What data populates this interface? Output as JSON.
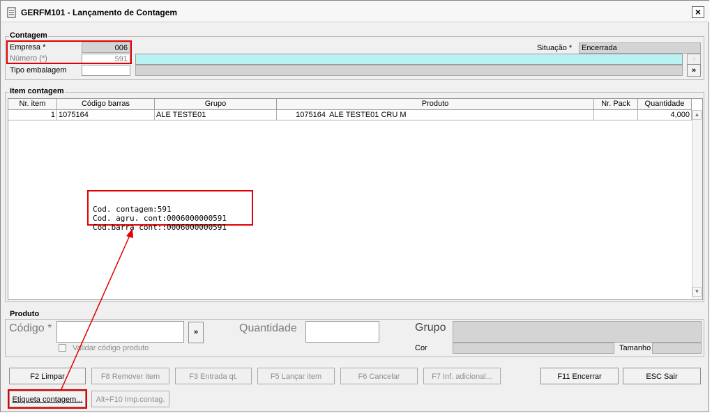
{
  "window": {
    "title": "GERFM101 - Lançamento de Contagem",
    "close_icon": "close-icon"
  },
  "contagem": {
    "legend": "Contagem",
    "empresa_label": "Empresa *",
    "empresa_value": "006",
    "numero_label": "Número (*)",
    "numero_value": "591",
    "tipo_label": "Tipo embalagem",
    "tipo_value": "",
    "situacao_label": "Situação *",
    "situacao_value": "Encerrada",
    "more_label": "»"
  },
  "item_contagem": {
    "legend": "Item contagem",
    "columns": [
      "Nr. item",
      "Código barras",
      "Grupo",
      "Produto",
      "Nr. Pack",
      "Quantidade"
    ],
    "rows": [
      {
        "nr_item": "1",
        "codigo_barras": "1075164",
        "grupo": "ALE TESTE01",
        "produto_code": "1075164",
        "produto_name": "ALE TESTE01 CRU M",
        "nr_pack": "",
        "quantidade": "4,000"
      }
    ]
  },
  "tooltip": {
    "line1": "Cod. contagem:591",
    "line2": "Cod. agru. cont:0006000000591",
    "line3": "Cod.barra cont::0006000000591"
  },
  "produto": {
    "legend": "Produto",
    "codigo_label": "Código *",
    "more_label": "»",
    "quantidade_label": "Quantidade",
    "grupo_label": "Grupo",
    "validar_label": "Validar código produto",
    "cor_label": "Cor",
    "tamanho_label": "Tamanho"
  },
  "buttons": {
    "f2": "F2 Limpar",
    "f8": "F8 Remover item",
    "f3": "F3 Entrada qt.",
    "f5": "F5 Lançar item",
    "f6": "F6 Cancelar",
    "f7": "F7 Inf. adicional...",
    "f11": "F11 Encerrar",
    "esc": "ESC Sair",
    "etiqueta": "Etiqueta contagem...",
    "altf10": "Alt+F10 Imp.contag."
  },
  "colors": {
    "highlight": "#e00000",
    "field_cyan": "#b9f2f2",
    "readonly": "#d4d4d4"
  }
}
